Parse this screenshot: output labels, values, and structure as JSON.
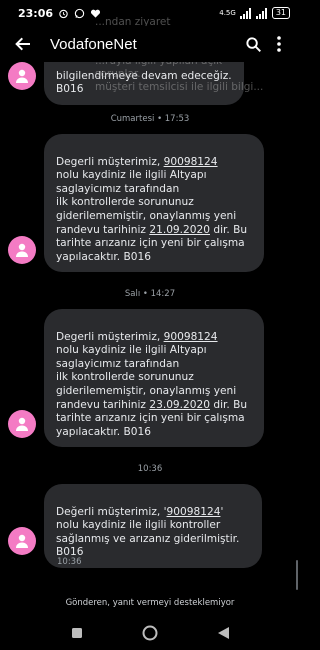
{
  "status_bar": {
    "time": "23:06",
    "icons": [
      "alarm-icon",
      "whatsapp-icon",
      "heart-icon"
    ],
    "network": "4.5G",
    "battery": "31"
  },
  "app_bar": {
    "title": "VodafoneNet",
    "back_icon": "back-arrow-icon",
    "search_icon": "search-icon",
    "menu_icon": "more-vert-icon"
  },
  "background_text": "...ndan ziyaret edilmediz...lekebilir. Arızanız giderilene...\n...ruyla ilgili yapılan açık sorunlar...\nmüşteri temsilcisi ile ilgili bilgi...",
  "messages": [
    {
      "type": "partial",
      "text": "bilgilendirmeye devam edeceğiz.\nB016"
    },
    {
      "separator": "Cumartesi • 17:53",
      "pre": "Degerli  müşterimiz, ",
      "number": "90098124",
      "mid": "\nnolu kaydiniz ile ilgili Altyapı\nsaglayicımız tarafından\nilk kontrollerde sorununuz\ngiderilememiştir, onaylanmış yeni\nrandevu tarihiniz ",
      "date": "21.09.2020",
      "post": " dir. Bu\ntarihte arızanız için yeni bir çalışma\nyapılacaktır. B016"
    },
    {
      "separator": "Salı • 14:27",
      "pre": "Degerli  müşterimiz, ",
      "number": "90098124",
      "mid": "\nnolu kaydiniz ile ilgili Altyapı\nsaglayicımız tarafından\nilk kontrollerde sorununuz\ngiderilememiştir, onaylanmış yeni\nrandevu tarihiniz ",
      "date": "23.09.2020",
      "post": " dir. Bu\ntarihte arızanız için yeni bir çalışma\nyapılacaktır. B016"
    },
    {
      "separator": "10:36",
      "pre": "Değerli müşterimiz, '",
      "number": "90098124",
      "post": "'\nnolu kaydiniz ile ilgili kontroller\nsağlanmış ve arızanız giderilmiştir.\nB016",
      "time": "10:36"
    }
  ],
  "footer_note": "Gönderen, yanıt vermeyi desteklemiyor",
  "nav": {
    "recents_icon": "square-icon",
    "home_icon": "home-circle-icon",
    "back_icon": "triangle-back-icon"
  },
  "colors": {
    "avatar": "#f47bc4",
    "bubble": "#2a2b2e",
    "background": "#000000"
  }
}
